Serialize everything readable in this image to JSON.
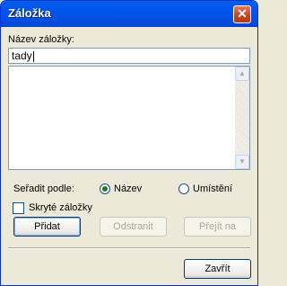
{
  "window": {
    "title": "Záložka",
    "close_glyph": "✕"
  },
  "form": {
    "name_label": "Název záložky:",
    "name_value": "tady",
    "list_items": []
  },
  "sort": {
    "label": "Seřadit podle:",
    "options": [
      {
        "label": "Název",
        "checked": true
      },
      {
        "label": "Umístění",
        "checked": false
      }
    ]
  },
  "hidden_bookmarks": {
    "label": "Skryté záložky",
    "checked": false
  },
  "buttons": {
    "add": "Přidat",
    "remove": "Odstranit",
    "go_to": "Přejít na",
    "close": "Zavřít"
  },
  "icons": {
    "close": "close-icon",
    "scroll_up": "arrow-up-icon",
    "scroll_down": "arrow-down-icon"
  }
}
